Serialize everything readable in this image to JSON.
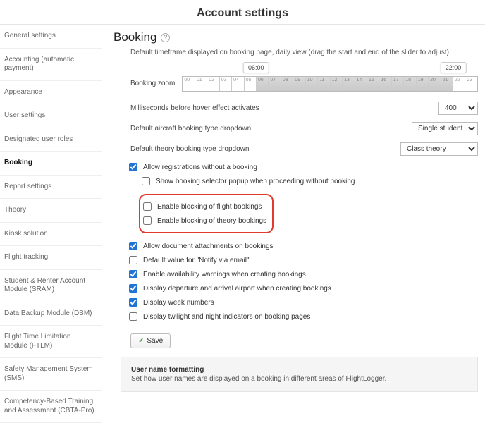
{
  "page_title": "Account settings",
  "sidebar": {
    "items": [
      {
        "label": "General settings"
      },
      {
        "label": "Accounting (automatic payment)"
      },
      {
        "label": "Appearance"
      },
      {
        "label": "User settings"
      },
      {
        "label": "Designated user roles"
      },
      {
        "label": "Booking",
        "active": true
      },
      {
        "label": "Report settings"
      },
      {
        "label": "Theory"
      },
      {
        "label": "Kiosk solution"
      },
      {
        "label": "Flight tracking"
      },
      {
        "label": "Student & Renter Account Module (SRAM)"
      },
      {
        "label": "Data Backup Module (DBM)"
      },
      {
        "label": "Flight Time Limitation Module (FTLM)"
      },
      {
        "label": "Safety Management System (SMS)"
      },
      {
        "label": "Competency-Based Training and Assessment (CBTA-Pro)"
      }
    ]
  },
  "section": {
    "heading": "Booking",
    "help": "?",
    "timeframe_desc": "Default timeframe displayed on booking page, daily view (drag the start and end of the slider to adjust)",
    "zoom_label": "Booking zoom",
    "start_time": "06:00",
    "end_time": "22:00",
    "hours": [
      "00",
      "01",
      "02",
      "03",
      "04",
      "05",
      "06",
      "07",
      "08",
      "09",
      "10",
      "11",
      "12",
      "13",
      "14",
      "15",
      "16",
      "17",
      "18",
      "19",
      "20",
      "21",
      "22",
      "23"
    ]
  },
  "settings": {
    "hover_label": "Milliseconds before hover effect activates",
    "hover_value": "400",
    "aircraft_label": "Default aircraft booking type dropdown",
    "aircraft_value": "Single student",
    "theory_label": "Default theory booking type dropdown",
    "theory_value": "Class theory"
  },
  "checks": {
    "allow_reg": "Allow registrations without a booking",
    "show_selector": "Show booking selector popup when proceeding without booking",
    "block_flight": "Enable blocking of flight bookings",
    "block_theory": "Enable blocking of theory bookings",
    "allow_docs": "Allow document attachments on bookings",
    "notify_email": "Default value for \"Notify via email\"",
    "avail_warn": "Enable availability warnings when creating bookings",
    "dep_arr": "Display departure and arrival airport when creating bookings",
    "week_nums": "Display week numbers",
    "twilight": "Display twilight and night indicators on booking pages"
  },
  "save_label": "Save",
  "footer": {
    "title": "User name formatting",
    "desc": "Set how user names are displayed on a booking in different areas of FlightLogger."
  }
}
